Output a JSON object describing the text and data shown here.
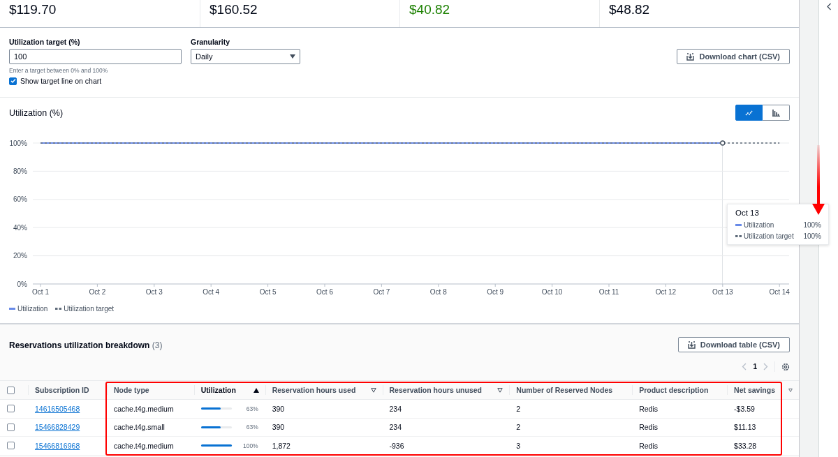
{
  "summary_cards": [
    {
      "value": "$119.70",
      "color": "#000716"
    },
    {
      "value": "$160.52",
      "color": "#000716"
    },
    {
      "value": "$40.82",
      "color": "#1d8102"
    },
    {
      "value": "$48.82",
      "color": "#000716"
    }
  ],
  "controls": {
    "target": {
      "label": "Utilization target (%)",
      "value": "100",
      "hint": "Enter a target between 0% and 100%"
    },
    "granularity": {
      "label": "Granularity",
      "value": "Daily"
    },
    "show_target": {
      "label": "Show target line on chart",
      "checked": true
    },
    "download_button": "Download chart (CSV)"
  },
  "chart_section": {
    "title": "Utilization (%)",
    "view_toggle": [
      {
        "kind": "line",
        "selected": true
      },
      {
        "kind": "bar",
        "selected": false
      }
    ],
    "chart_data": {
      "type": "line",
      "grid": true,
      "categories": [
        "Oct 1",
        "Oct 2",
        "Oct 3",
        "Oct 4",
        "Oct 5",
        "Oct 6",
        "Oct 7",
        "Oct 8",
        "Oct 9",
        "Oct 10",
        "Oct 11",
        "Oct 12",
        "Oct 13",
        "Oct 14"
      ],
      "ylim": [
        0,
        100
      ],
      "yticks": [
        {
          "value": 0,
          "label": "0%"
        },
        {
          "value": 20,
          "label": "20%"
        },
        {
          "value": 40,
          "label": "40%"
        },
        {
          "value": 60,
          "label": "60%"
        },
        {
          "value": 80,
          "label": "80%"
        },
        {
          "value": 100,
          "label": "100%"
        }
      ],
      "series": [
        {
          "name": "Utilization",
          "color": "#688ae8",
          "values": [
            100,
            100,
            100,
            100,
            100,
            100,
            100,
            100,
            100,
            100,
            100,
            100,
            100,
            null
          ]
        },
        {
          "name": "Utilization target",
          "color": "#5f6b7a",
          "line_style": "dashed",
          "values": [
            100,
            100,
            100,
            100,
            100,
            100,
            100,
            100,
            100,
            100,
            100,
            100,
            100,
            100
          ]
        }
      ]
    },
    "tooltip": {
      "title": "Oct 13",
      "rows": [
        {
          "label": "Utilization",
          "value": "100%"
        },
        {
          "label": "Utilization target",
          "value": "100%"
        }
      ]
    }
  },
  "breakdown": {
    "title": "Reservations utilization breakdown",
    "count": "(3)",
    "download_button": "Download table (CSV)",
    "page": "1",
    "select_all_checked": false,
    "columns": [
      {
        "label": "Subscription ID",
        "sortable": false,
        "sorted": false
      },
      {
        "label": "Node type",
        "sortable": false,
        "sorted": false
      },
      {
        "label": "Utilization",
        "sortable": true,
        "sorted": true
      },
      {
        "label": "Reservation hours used",
        "sortable": true,
        "sorted": false
      },
      {
        "label": "Reservation hours unused",
        "sortable": true,
        "sorted": false
      },
      {
        "label": "Number of Reserved Nodes",
        "sortable": false,
        "sorted": false
      },
      {
        "label": "Product description",
        "sortable": false,
        "sorted": false
      },
      {
        "label": "Net savings",
        "sortable": false,
        "sorted": false
      },
      {
        "sortable": true,
        "sorted": false
      }
    ],
    "rows": [
      {
        "checked": false,
        "subscription_id": "14616505468",
        "node_type": "cache.t4g.medium",
        "utilization": {
          "level": 0.63,
          "text": "63%"
        },
        "hours_used": "390",
        "hours_unused": "234",
        "nodes": "2",
        "product": "Redis",
        "net_savings": "-$3.59"
      },
      {
        "checked": false,
        "subscription_id": "15466828429",
        "node_type": "cache.t4g.small",
        "utilization": {
          "level": 0.63,
          "text": "63%"
        },
        "hours_used": "390",
        "hours_unused": "234",
        "nodes": "2",
        "product": "Redis",
        "net_savings": "$11.13"
      },
      {
        "checked": false,
        "subscription_id": "15466816968",
        "node_type": "cache.t4g.medium",
        "utilization": {
          "level": 1,
          "text": "100%"
        },
        "hours_used": "1,872",
        "hours_unused": "-936",
        "nodes": "3",
        "product": "Redis",
        "net_savings": "$33.28"
      }
    ]
  },
  "annotations": {
    "highlight_frame": true,
    "arrow": true
  }
}
